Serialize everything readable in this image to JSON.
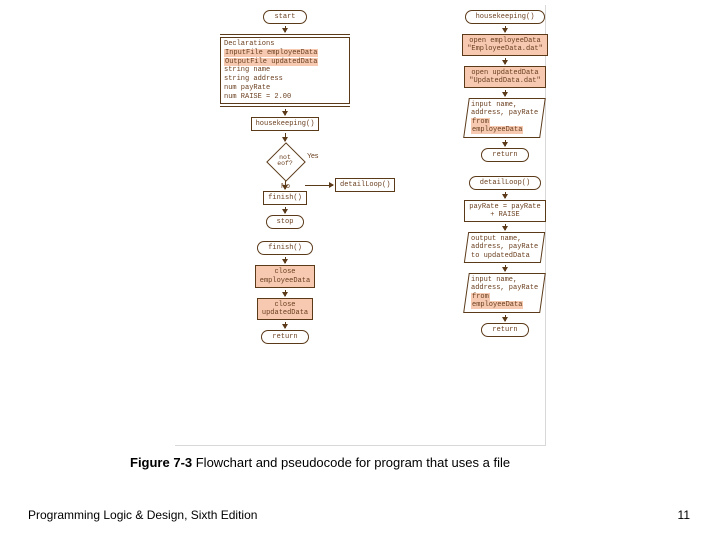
{
  "caption_label": "Figure 7-3",
  "caption_text": " Flowchart and pseudocode for program that uses a file",
  "footer_left": "Programming Logic & Design, Sixth Edition",
  "footer_right": "11",
  "left": {
    "start": "start",
    "decl_title": "Declarations",
    "decl_lines": [
      {
        "t": "InputFile employeeData",
        "hl": true
      },
      {
        "t": "OutputFile updatedData",
        "hl": true
      },
      {
        "t": "string name",
        "hl": false
      },
      {
        "t": "string address",
        "hl": false
      },
      {
        "t": "num payRate",
        "hl": false
      },
      {
        "t": "num RAISE = 2.00",
        "hl": false
      }
    ],
    "hk": "housekeeping()",
    "diamond": "not\neof?",
    "yes": "Yes",
    "no": "No",
    "detail": "detailLoop()",
    "finish_rect": "finish()",
    "stop": "stop",
    "finish_term": "finish()",
    "close1": "close\nemployeeData",
    "close2": "close\nupdatedData",
    "return": "return"
  },
  "right": {
    "hk": "housekeeping()",
    "open1": "open employeeData\n\"EmployeeData.dat\"",
    "open2": "open updatedData\n\"UpdatedData.dat\"",
    "input1_a": "input name,\naddress, payRate",
    "input1_from": "from",
    "input1_b": "employeeData",
    "return1": "return",
    "detail": "detailLoop()",
    "calc": "payRate = payRate\n+ RAISE",
    "output": "output name,\naddress, payRate\nto updatedData",
    "input2_a": "input name,\naddress, payRate",
    "input2_from": "from",
    "input2_b": "employeeData",
    "return2": "return"
  }
}
